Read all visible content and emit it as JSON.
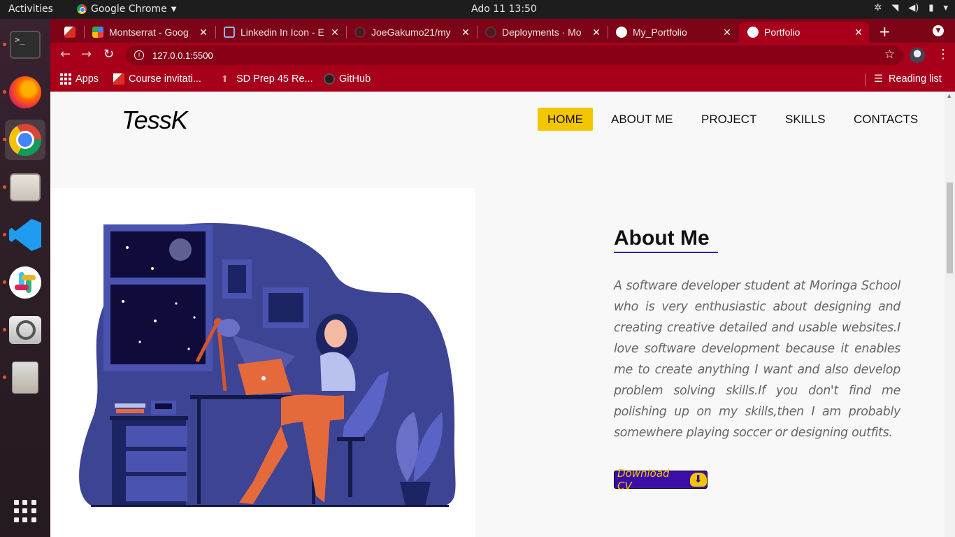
{
  "topbar": {
    "activities": "Activities",
    "app_name": "Google Chrome",
    "clock": "Ado 11  13:50"
  },
  "dock": {
    "items": [
      "terminal-icon",
      "firefox-icon",
      "chrome-icon",
      "files-icon",
      "vscode-icon",
      "slack-icon",
      "image-viewer-icon",
      "archive-icon"
    ]
  },
  "tabs": [
    {
      "label": ""
    },
    {
      "label": "Montserrat - Goog"
    },
    {
      "label": "Linkedin In Icon - E"
    },
    {
      "label": "JoeGakumo21/my"
    },
    {
      "label": "Deployments · Mo"
    },
    {
      "label": "My_Portfolio"
    },
    {
      "label": "Portfolio"
    }
  ],
  "address": {
    "url": "127.0.0.1:5500"
  },
  "bookmarks": [
    {
      "label": "Apps"
    },
    {
      "label": "Course invitati..."
    },
    {
      "label": "SD Prep 45 Re..."
    },
    {
      "label": "GitHub"
    }
  ],
  "reading_list": "Reading list",
  "page": {
    "logo": "TessK",
    "nav": [
      "HOME",
      "ABOUT ME",
      "PROJECT",
      "SKILLS",
      "CONTACTS"
    ],
    "about_title": "About Me",
    "about_text": "A software developer student at Moringa School who is very enthusiastic about designing and creating creative detailed and usable websites.I love software development because it enables me to create anything I want and also develop problem solving skills.If you don't find me polishing up on my skills,then I am probably somewhere playing soccer or designing outfits.",
    "cv_button": "Download CV"
  },
  "colors": {
    "chrome_frame": "#a8001b",
    "accent_yellow": "#f2c600",
    "accent_purple": "#3b0ea8",
    "illustration_blue": "#3e4494"
  }
}
